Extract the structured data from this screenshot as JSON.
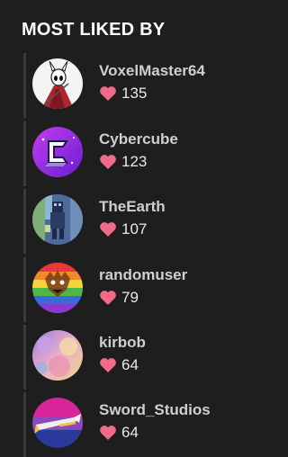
{
  "heading": "MOST LIKED BY",
  "colors": {
    "background": "#1e1e1e",
    "heart": "#f06b8a",
    "divider": "#3a3a3a"
  },
  "users": [
    {
      "name": "VoxelMaster64",
      "likes": "135",
      "avatar_icon": "knight-avatar"
    },
    {
      "name": "Cybercube",
      "likes": "123",
      "avatar_icon": "cube-logo-avatar"
    },
    {
      "name": "TheEarth",
      "likes": "107",
      "avatar_icon": "pixel-figure-avatar"
    },
    {
      "name": "randomuser",
      "likes": "79",
      "avatar_icon": "rainbow-pattern-avatar"
    },
    {
      "name": "kirbob",
      "likes": "64",
      "avatar_icon": "pastel-blur-avatar"
    },
    {
      "name": "Sword_Studios",
      "likes": "64",
      "avatar_icon": "sword-logo-avatar"
    }
  ]
}
